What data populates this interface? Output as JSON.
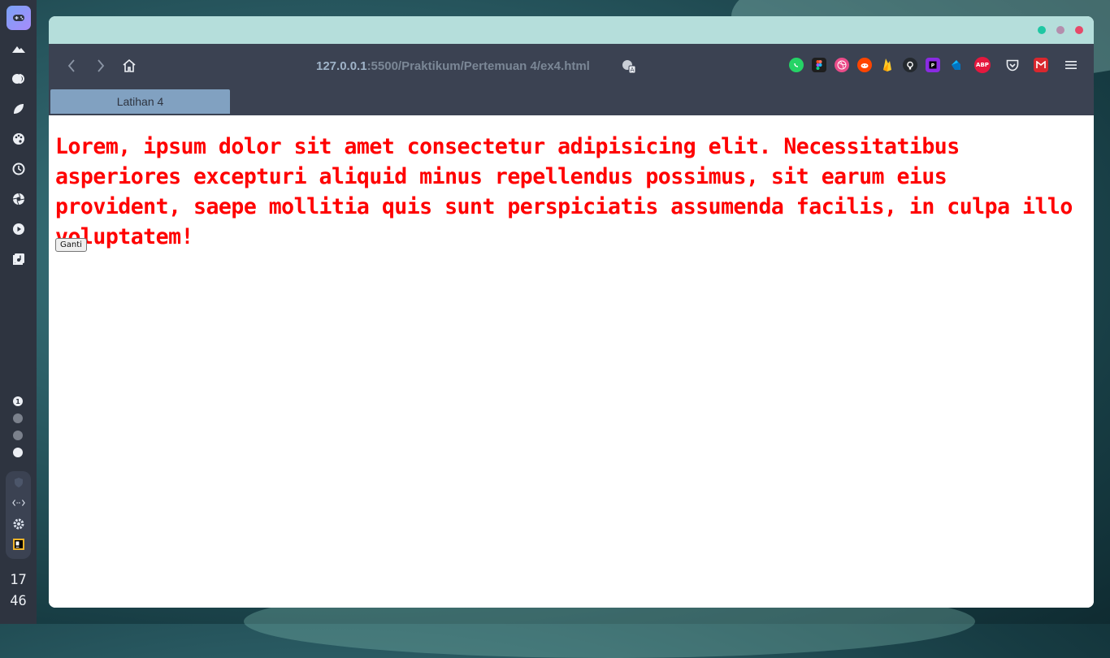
{
  "colors": {
    "dock_bg": "#2e3440",
    "titlebar_bg": "#b5dedb",
    "toolbar_bg": "#3b4252",
    "tab_bg": "#81a1c1",
    "text_red": "#ff0000",
    "win_green": "#1fc7a3",
    "win_purple": "#b48ead",
    "win_red": "#e64969"
  },
  "dock": {
    "app_icon": "gamepad-icon",
    "icons": [
      "mountain-icon",
      "toggle-icon",
      "leaf-icon",
      "palette-icon",
      "history-icon",
      "aperture-icon",
      "play-icon",
      "music-library-icon"
    ],
    "workspaces": {
      "active_label": "1"
    },
    "tray_icons": [
      "shield-icon",
      "network-icon",
      "settings-icon",
      "pycharm-icon"
    ],
    "clock": {
      "hour": "17",
      "minute": "46"
    }
  },
  "browser": {
    "url_host": "127.0.0.1",
    "url_rest": ":5500/Praktikum/Pertemuan 4/ex4.html",
    "toolbar_icons": [
      "back-icon",
      "forward-icon",
      "home-icon",
      "translate-icon"
    ],
    "extensions": [
      "whatsapp-icon",
      "figma-icon",
      "dribbble-icon",
      "reddit-icon",
      "firebase-icon",
      "github-icon",
      "phpstorm-icon",
      "dart-icon",
      "adblock-plus-icon",
      "pocket-icon",
      "mega-icon",
      "menu-icon"
    ],
    "extension_labels": {
      "adblock": "ABP"
    },
    "tab": {
      "title": "Latihan 4"
    }
  },
  "page": {
    "paragraph": "Lorem, ipsum dolor sit amet consectetur adipisicing elit. Necessitatibus asperiores excepturi aliquid minus repellendus possimus, sit earum eius provident, saepe mollitia quis sunt perspiciatis assumenda facilis, in culpa illo voluptatem!",
    "button_label": "Ganti"
  }
}
